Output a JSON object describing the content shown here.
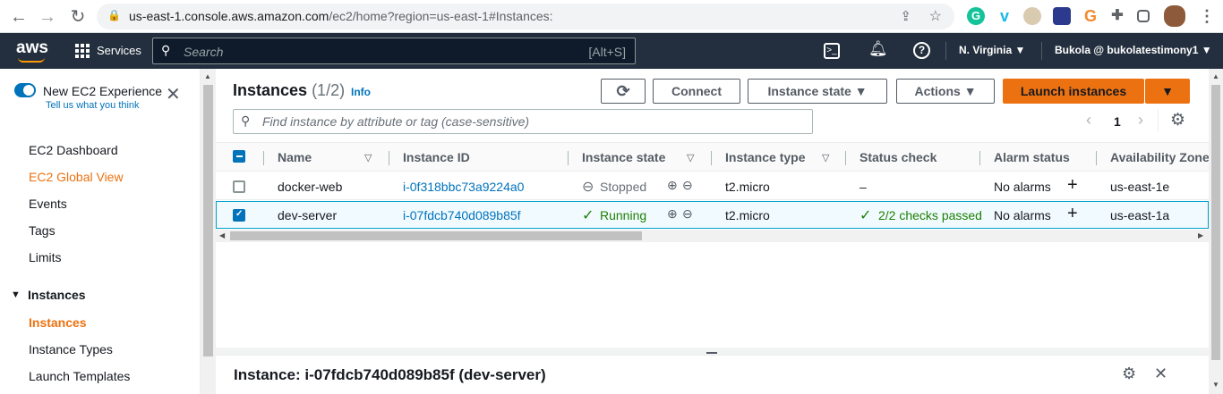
{
  "browser": {
    "url_host": "us-east-1.console.aws.amazon.com",
    "url_path": "/ec2/home?region=us-east-1#Instances:"
  },
  "aws": {
    "logo": "aws",
    "services_label": "Services",
    "search_placeholder": "Search",
    "search_shortcut": "[Alt+S]",
    "region": "N. Virginia",
    "account": "Bukola @ bukolatestimony1"
  },
  "sidebar": {
    "toggle_label": "New EC2 Experience",
    "toggle_sub": "Tell us what you think",
    "items": [
      {
        "label": "EC2 Dashboard",
        "active": false
      },
      {
        "label": "EC2 Global View",
        "active": true
      },
      {
        "label": "Events",
        "active": false
      },
      {
        "label": "Tags",
        "active": false
      },
      {
        "label": "Limits",
        "active": false
      }
    ],
    "section": "Instances",
    "section_items": [
      {
        "label": "Instances",
        "active": true
      },
      {
        "label": "Instance Types",
        "active": false
      },
      {
        "label": "Launch Templates",
        "active": false
      }
    ]
  },
  "instances": {
    "title": "Instances",
    "count": "(1/2)",
    "info": "Info",
    "buttons": {
      "connect": "Connect",
      "instance_state": "Instance state",
      "actions": "Actions",
      "launch": "Launch instances"
    },
    "filter_placeholder": "Find instance by attribute or tag (case-sensitive)",
    "page": "1",
    "columns": [
      "Name",
      "Instance ID",
      "Instance state",
      "Instance type",
      "Status check",
      "Alarm status",
      "Availability Zone"
    ],
    "rows": [
      {
        "selected": false,
        "name": "docker-web",
        "id": "i-0f318bbc73a9224a0",
        "state": "Stopped",
        "type": "t2.micro",
        "status": "–",
        "alarm": "No alarms",
        "az": "us-east-1e"
      },
      {
        "selected": true,
        "name": "dev-server",
        "id": "i-07fdcb740d089b85f",
        "state": "Running",
        "type": "t2.micro",
        "status": "2/2 checks passed",
        "alarm": "No alarms",
        "az": "us-east-1a"
      }
    ]
  },
  "detail": {
    "title": "Instance: i-07fdcb740d089b85f (dev-server)"
  }
}
